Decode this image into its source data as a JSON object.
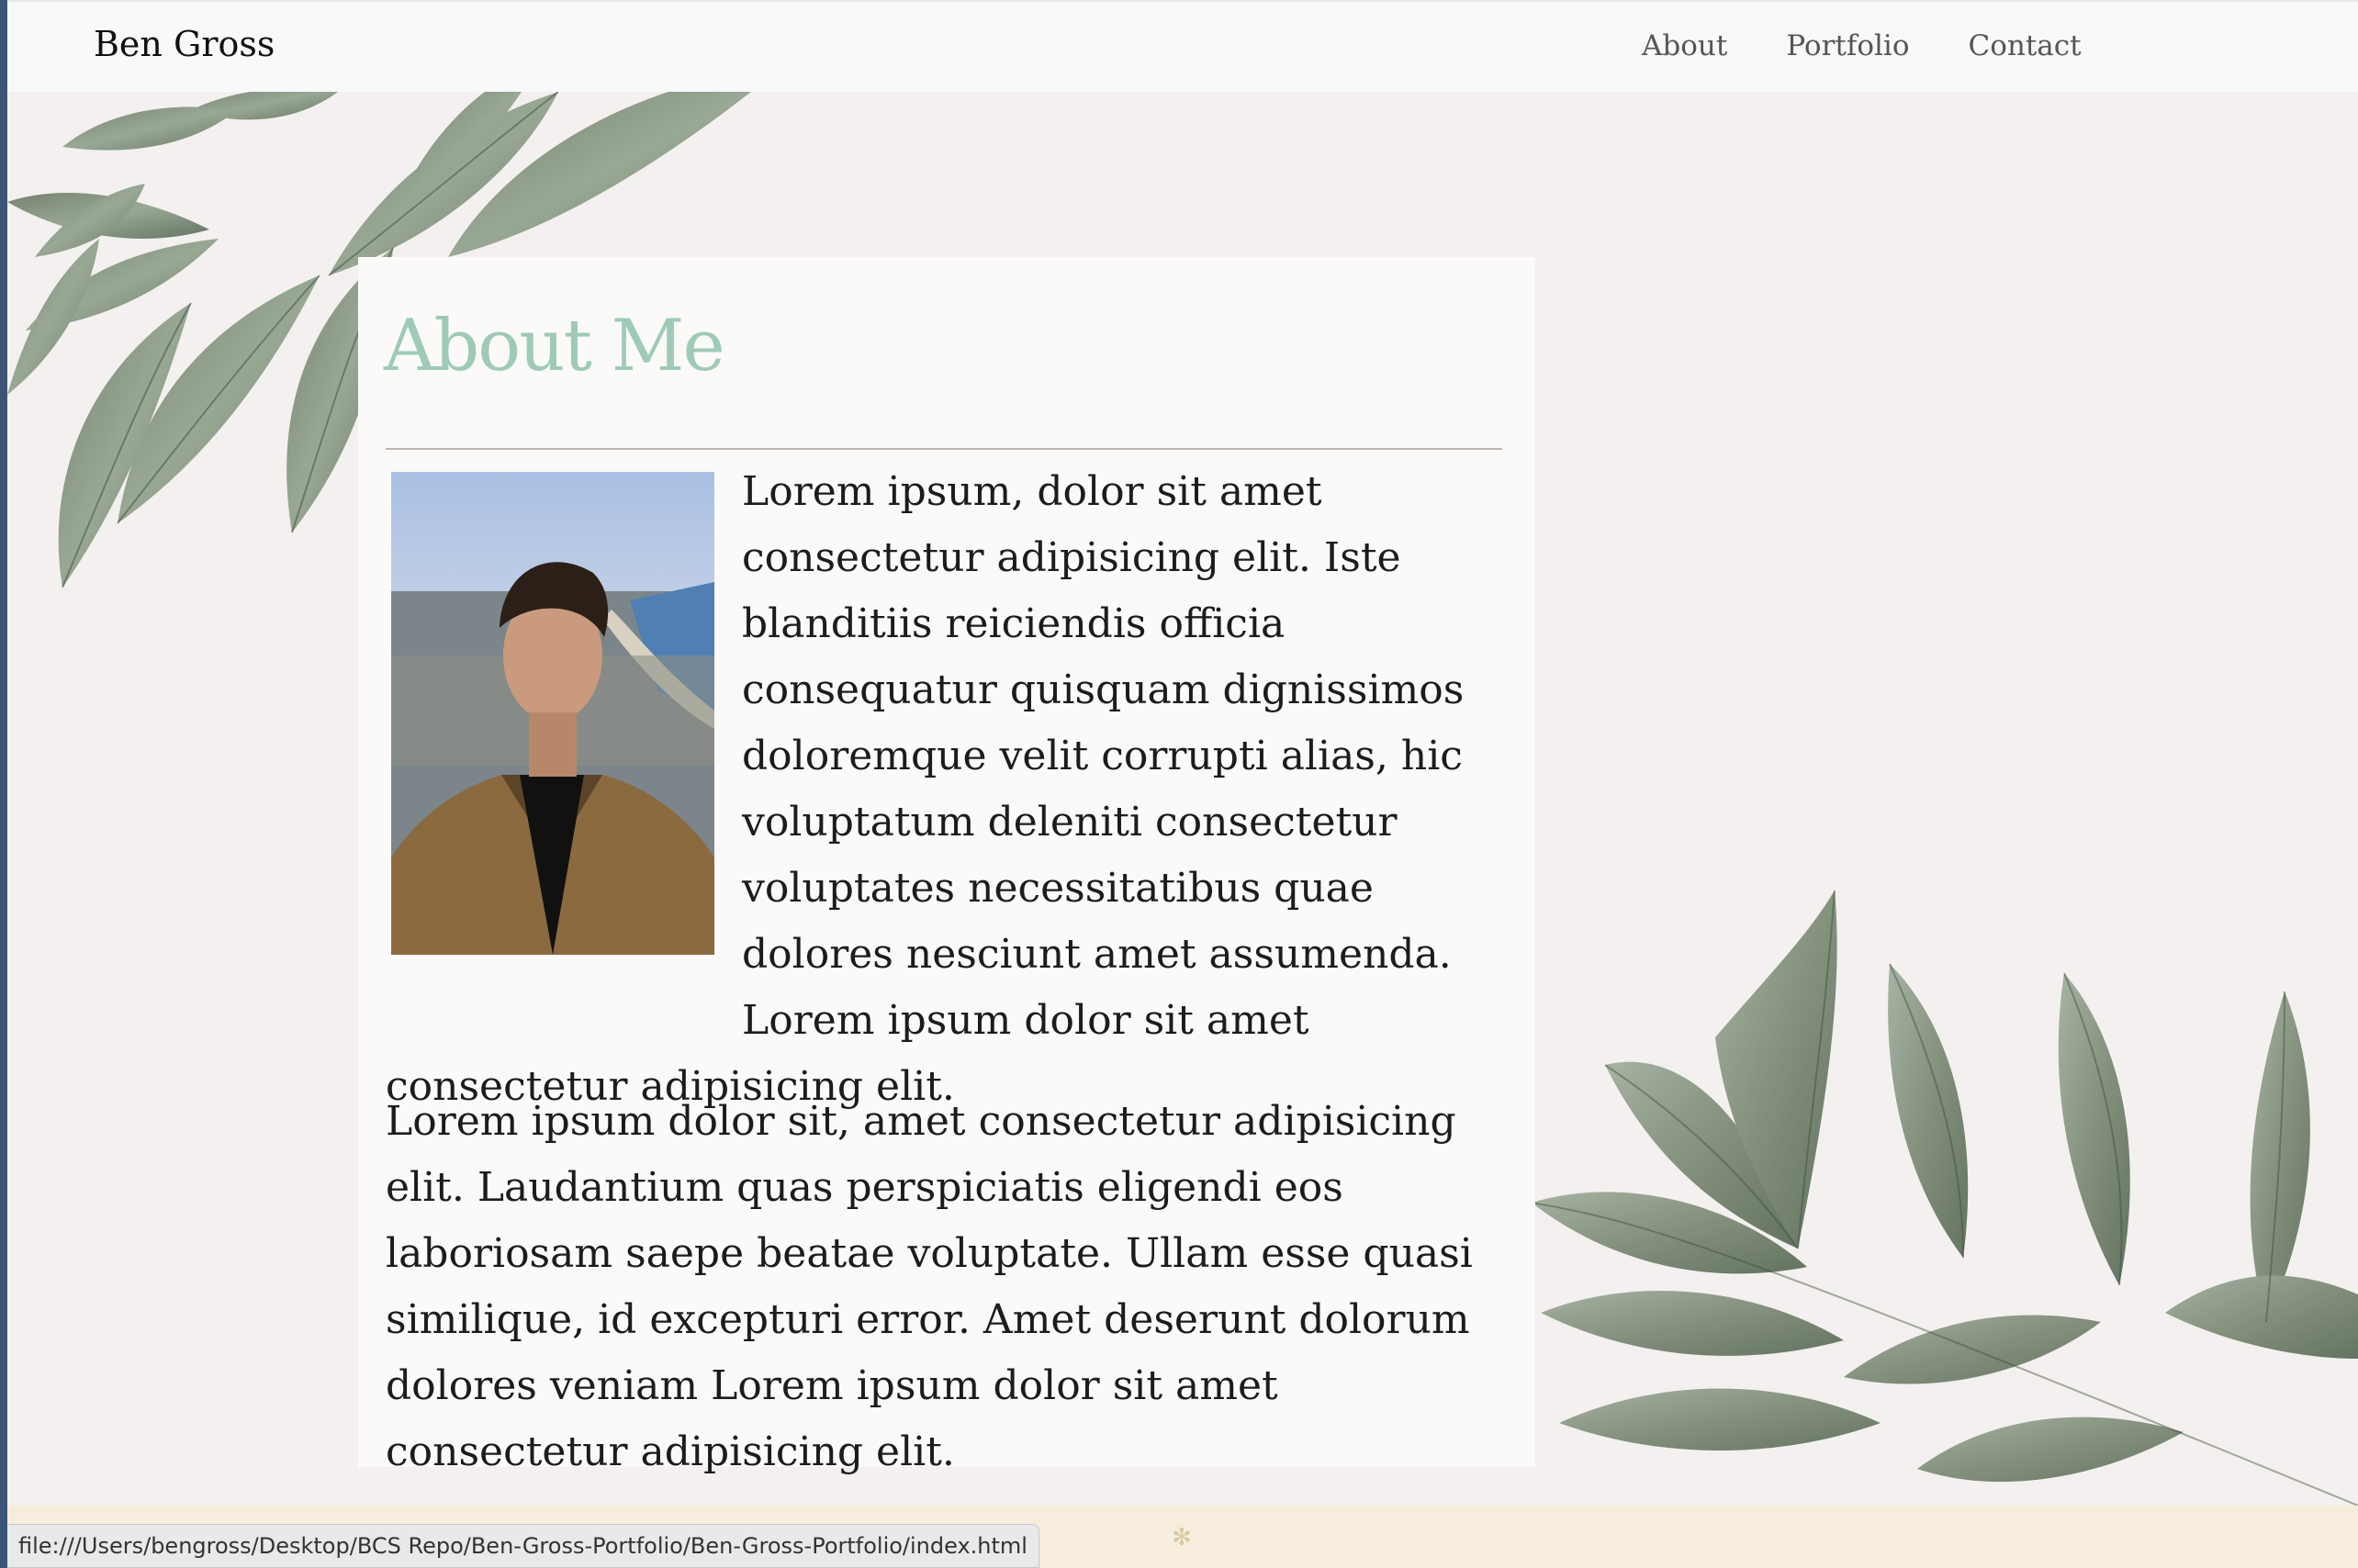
{
  "navbar": {
    "brand": "Ben Gross",
    "links": [
      "About",
      "Portfolio",
      "Contact"
    ]
  },
  "about": {
    "heading": "About Me",
    "photo_alt": "Portrait of Ben Gross",
    "paragraph_1": "Lorem ipsum, dolor sit amet consectetur adipisicing elit. Iste blanditiis reiciendis officia consequatur quisquam dignissimos doloremque velit corrupti alias, hic voluptatum deleniti consectetur voluptates necessitatibus quae dolores nesciunt amet assumenda. Lorem ipsum dolor sit amet consectetur adipisicing elit.",
    "paragraph_2": "Lorem ipsum dolor sit, amet consectetur adipisicing elit. Laudantium quas perspiciatis eligendi eos laboriosam saepe beatae voluptate. Ullam esse quasi similique, id excepturi error. Amet deserunt dolorum dolores veniam Lorem ipsum dolor sit amet consectetur adipisicing elit."
  },
  "status_bar": {
    "url": "file:///Users/bengross/Desktop/BCS Repo/Ben-Gross-Portfolio/Ben-Gross-Portfolio/index.html"
  },
  "colors": {
    "heading": "#9fcab8",
    "leaf": "#7c8f78",
    "navbar_bg": "#f8f9fa",
    "page_bg": "#f3f0ef"
  }
}
